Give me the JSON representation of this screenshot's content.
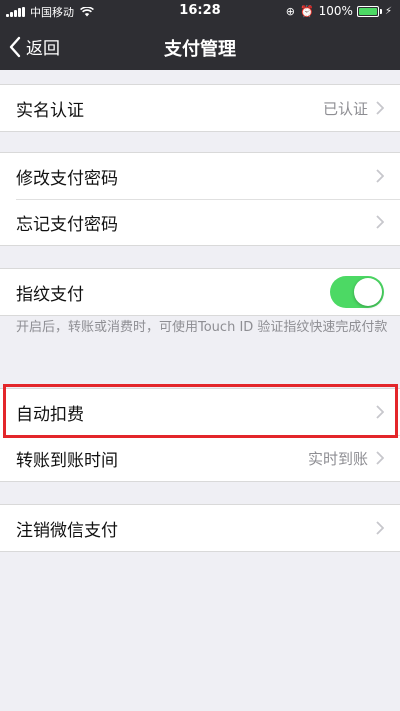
{
  "status_bar": {
    "carrier": "中国移动",
    "time": "16:28",
    "battery": "100%",
    "battery_color": "#4cd964"
  },
  "nav": {
    "back_label": "返回",
    "title": "支付管理"
  },
  "rows": {
    "real_name": {
      "label": "实名认证",
      "value": "已认证"
    },
    "change_password": {
      "label": "修改支付密码"
    },
    "forgot_password": {
      "label": "忘记支付密码"
    },
    "fingerprint": {
      "label": "指纹支付",
      "enabled": true
    },
    "auto_deduct": {
      "label": "自动扣费"
    },
    "transfer_time": {
      "label": "转账到账时间",
      "value": "实时到账"
    },
    "close_pay": {
      "label": "注销微信支付"
    }
  },
  "fingerprint_hint": "开启后，转账或消费时，可使用Touch ID 验证指纹快速完成付款",
  "colors": {
    "nav_background": "#2e2e33",
    "page_background": "#efeff4",
    "toggle_on": "#4cd964",
    "highlight_border": "#e3262a"
  },
  "icons": [
    "signal-icon",
    "wifi-icon",
    "lock-rotation-icon",
    "alarm-icon",
    "battery-icon",
    "charging-icon",
    "back-chevron-icon",
    "chevron-right-icon"
  ]
}
